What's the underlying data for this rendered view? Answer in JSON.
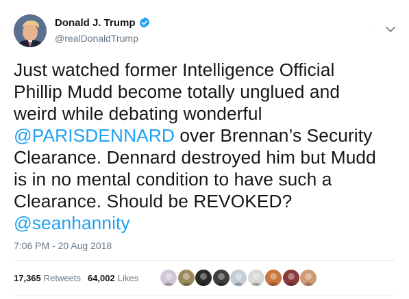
{
  "author": {
    "display_name": "Donald J. Trump",
    "handle": "@realDonaldTrump",
    "verified": true,
    "avatar_icon": "profile-photo-avatar",
    "verified_color": "#1da1f2"
  },
  "tweet": {
    "lines": [
      [
        {
          "text": "Just watched former Intelligence Official",
          "link": false
        }
      ],
      [
        {
          "text": "Phillip Mudd become totally unglued and",
          "link": false
        }
      ],
      [
        {
          "text": "weird while debating wonderful",
          "link": false
        }
      ],
      [
        {
          "text": "@PARISDENNARD",
          "link": true
        },
        {
          "text": " over Brennan’s Security",
          "link": false
        }
      ],
      [
        {
          "text": "Clearance. Dennard destroyed him but Mudd",
          "link": false
        }
      ],
      [
        {
          "text": "is in no mental condition to have such a",
          "link": false
        }
      ],
      [
        {
          "text": "Clearance. Should be REVOKED?",
          "link": false
        }
      ],
      [
        {
          "text": "@seanhannity",
          "link": true
        }
      ]
    ],
    "timestamp": "7:06 PM - 20 Aug 2018",
    "link_color": "#1da1f2"
  },
  "stats": {
    "retweets": "17,365",
    "retweets_label": "Retweets",
    "likes": "64,002",
    "likes_label": "Likes"
  },
  "likers": [
    {
      "icon": "liker-avatar-1",
      "color": "#cfc6d8"
    },
    {
      "icon": "liker-avatar-2",
      "color": "#9c8a5c"
    },
    {
      "icon": "liker-avatar-3",
      "color": "#2b2b2b"
    },
    {
      "icon": "liker-avatar-4",
      "color": "#3e3e3e"
    },
    {
      "icon": "liker-avatar-5",
      "color": "#c5ced6"
    },
    {
      "icon": "liker-avatar-6",
      "color": "#d8d8d8"
    },
    {
      "icon": "liker-avatar-7",
      "color": "#c8743e"
    },
    {
      "icon": "liker-avatar-8",
      "color": "#8a3a3a"
    },
    {
      "icon": "liker-avatar-9",
      "color": "#d09a74"
    }
  ]
}
